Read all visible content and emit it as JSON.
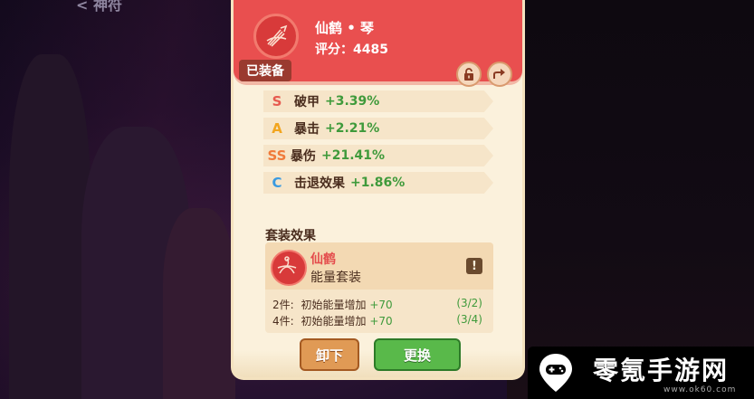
{
  "nav": {
    "back_label": "< 神符"
  },
  "item": {
    "name": "仙鹤 • 琴",
    "score": "评分：4485",
    "equipped_badge": "已装备",
    "color_header": "#e94f4f"
  },
  "stats": [
    {
      "grade": "S",
      "grade_color": "#e65a4f",
      "label": "破甲",
      "value": "+3.39%"
    },
    {
      "grade": "A",
      "grade_color": "#f2a51e",
      "label": "暴击",
      "value": "+2.21%"
    },
    {
      "grade": "SS",
      "grade_color": "#f07a3a",
      "label": "暴伤",
      "value": "+21.41%"
    },
    {
      "grade": "C",
      "grade_color": "#3a9ae0",
      "label": "击退效果",
      "value": "+1.86%"
    }
  ],
  "set": {
    "title": "套装效果",
    "name": "仙鹤",
    "type": "能量套装",
    "info_icon": "!",
    "bonuses": [
      {
        "req": "2件:",
        "desc": "初始能量增加",
        "value": "+70",
        "progress": "(3/2)"
      },
      {
        "req": "4件:",
        "desc": "初始能量增加",
        "value": "+70",
        "progress": "(3/4)"
      }
    ]
  },
  "buttons": {
    "unequip": "卸下",
    "replace": "更换"
  },
  "watermark": {
    "text": "零氪手游网",
    "url": "www.ok60.com"
  }
}
